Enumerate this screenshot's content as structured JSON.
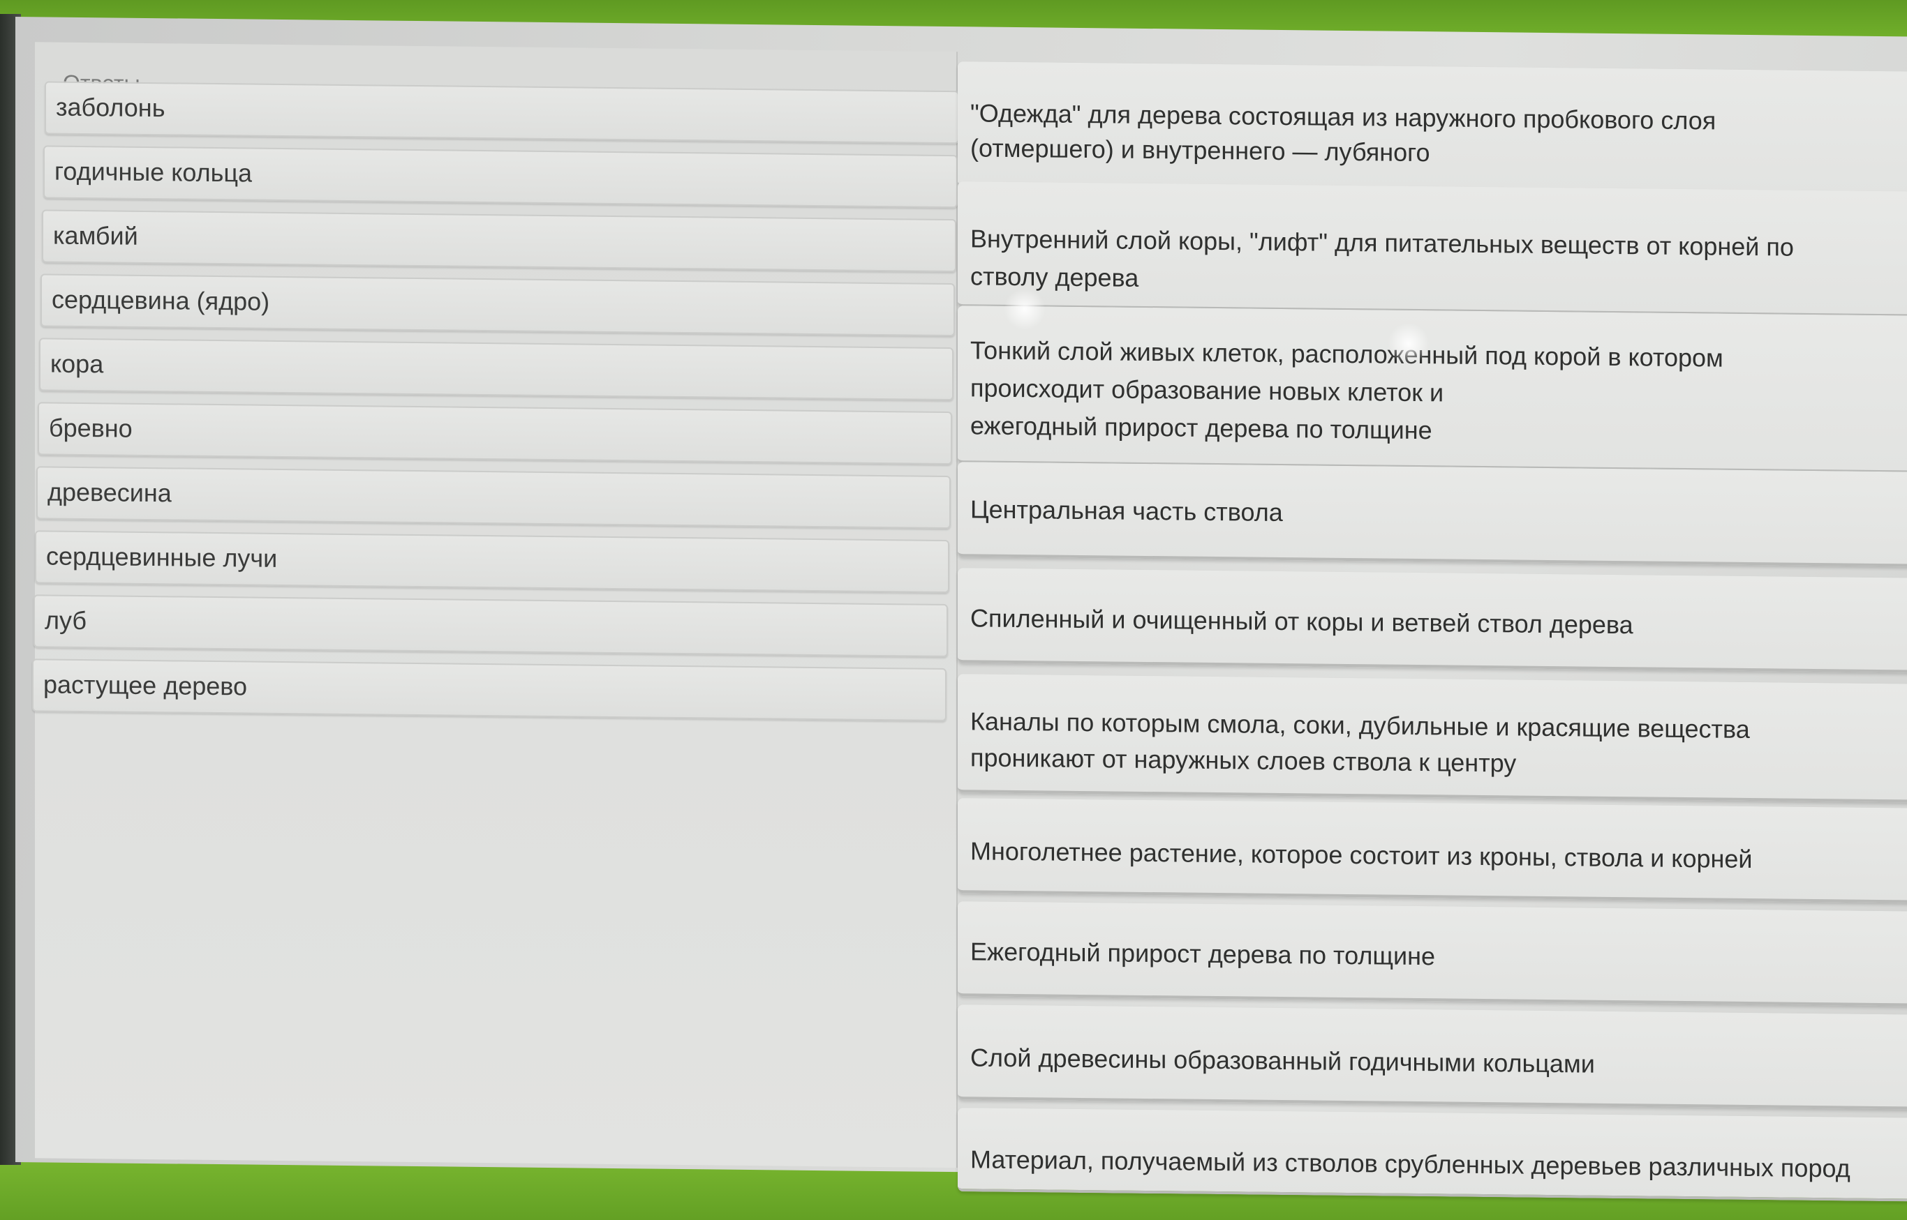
{
  "answers": {
    "title": "Ответы",
    "items": [
      {
        "label": "заболонь"
      },
      {
        "label": "годичные кольца"
      },
      {
        "label": "камбий"
      },
      {
        "label": "сердцевина (ядро)"
      },
      {
        "label": "кора"
      },
      {
        "label": "бревно"
      },
      {
        "label": "древесина"
      },
      {
        "label": "сердцевинные лучи"
      },
      {
        "label": "луб"
      },
      {
        "label": "растущее дерево"
      }
    ]
  },
  "definitions": [
    {
      "line1": "\"Одежда\" для дерева  состоящая из наружного пробкового слоя",
      "line2": "(отмершего) и внутреннего — лубяного",
      "line3": ""
    },
    {
      "line1": "Внутренний слой коры, \"лифт\" для питательных веществ от корней по",
      "line2": "стволу дерева",
      "line3": ""
    },
    {
      "line1": "Тонкий слой живых клеток, расположенный под корой  в котором",
      "line2": "происходит образование новых клеток и",
      "line3": "ежегодный прирост дерева по толщине"
    },
    {
      "line1": "Центральная часть ствола",
      "line2": "",
      "line3": ""
    },
    {
      "line1": "Спиленный и очищенный от коры и ветвей ствол дерева",
      "line2": "",
      "line3": ""
    },
    {
      "line1": "Каналы по которым смола, соки, дубильные и красящие вещества",
      "line2": "проникают от  наружных слоев ствола к центру",
      "line3": ""
    },
    {
      "line1": "Многолетнее растение, которое состоит из кроны, ствола и корней",
      "line2": "",
      "line3": ""
    },
    {
      "line1": "Ежегодный прирост дерева по толщине",
      "line2": "",
      "line3": ""
    },
    {
      "line1": "Слой древесины образованный годичными кольцами",
      "line2": "",
      "line3": ""
    },
    {
      "line1": "Материал, получаемый из стволов срубленных деревьев различных пород",
      "line2": "",
      "line3": ""
    }
  ]
}
